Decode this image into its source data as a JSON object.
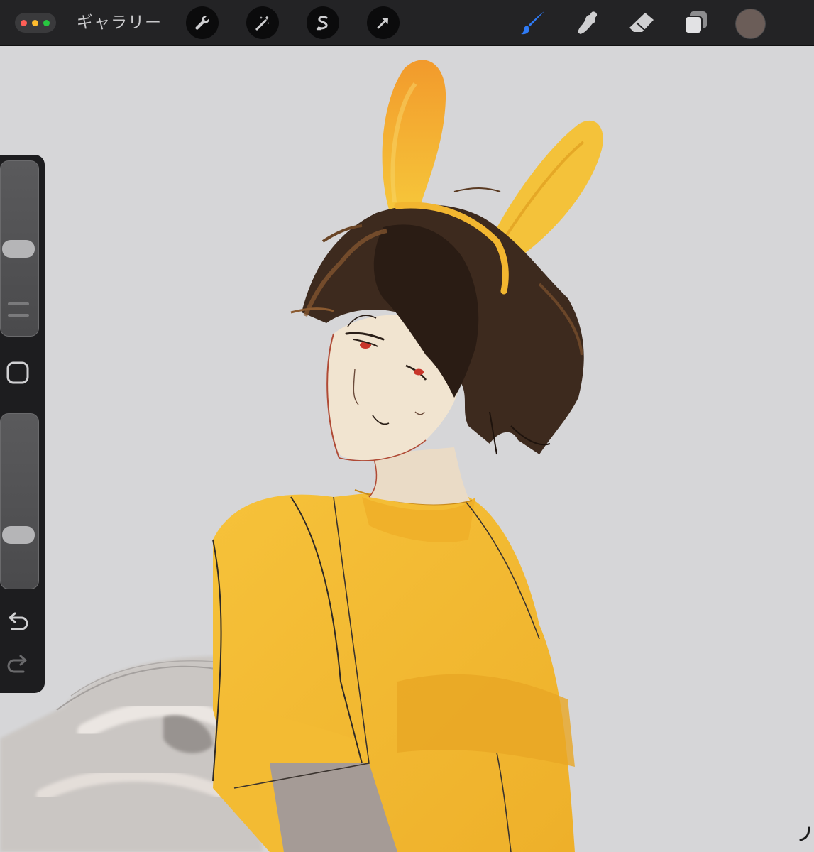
{
  "toolbar": {
    "gallery_label": "ギャラリー",
    "window_dots": [
      {
        "name": "close",
        "color": "#ff5f57"
      },
      {
        "name": "minimize",
        "color": "#febc2e"
      },
      {
        "name": "zoom",
        "color": "#28c840"
      }
    ],
    "left_tools": [
      {
        "id": "actions",
        "icon": "wrench-icon"
      },
      {
        "id": "adjustments",
        "icon": "magic-wand-icon"
      },
      {
        "id": "selection",
        "icon": "selection-s-icon"
      },
      {
        "id": "transform",
        "icon": "arrow-cursor-icon"
      }
    ],
    "right_tools": [
      {
        "id": "brush",
        "icon": "brush-icon",
        "active": true,
        "color": "#2f7bf6"
      },
      {
        "id": "smudge",
        "icon": "smudge-finger-icon",
        "active": false
      },
      {
        "id": "eraser",
        "icon": "eraser-icon",
        "active": false
      },
      {
        "id": "layers",
        "icon": "layers-icon",
        "active": false
      }
    ],
    "current_color": "#6b5d58"
  },
  "sidebar": {
    "brush_size_level": 0.5,
    "opacity_level": 0.28,
    "modify_button_icon": "square-outline-icon",
    "undo_icon": "undo-arrow-icon",
    "redo_icon": "redo-arrow-icon"
  },
  "canvas": {
    "background_color": "#d6d6d8",
    "artwork_subject": "illustration-boy-with-yellow-bunny-ears",
    "palette": {
      "shirt": "#f1b52a",
      "ears": "#f5c234",
      "hair": "#3d2a1e",
      "skin": "#f0e3cf",
      "eyes": "#c8352a"
    }
  }
}
